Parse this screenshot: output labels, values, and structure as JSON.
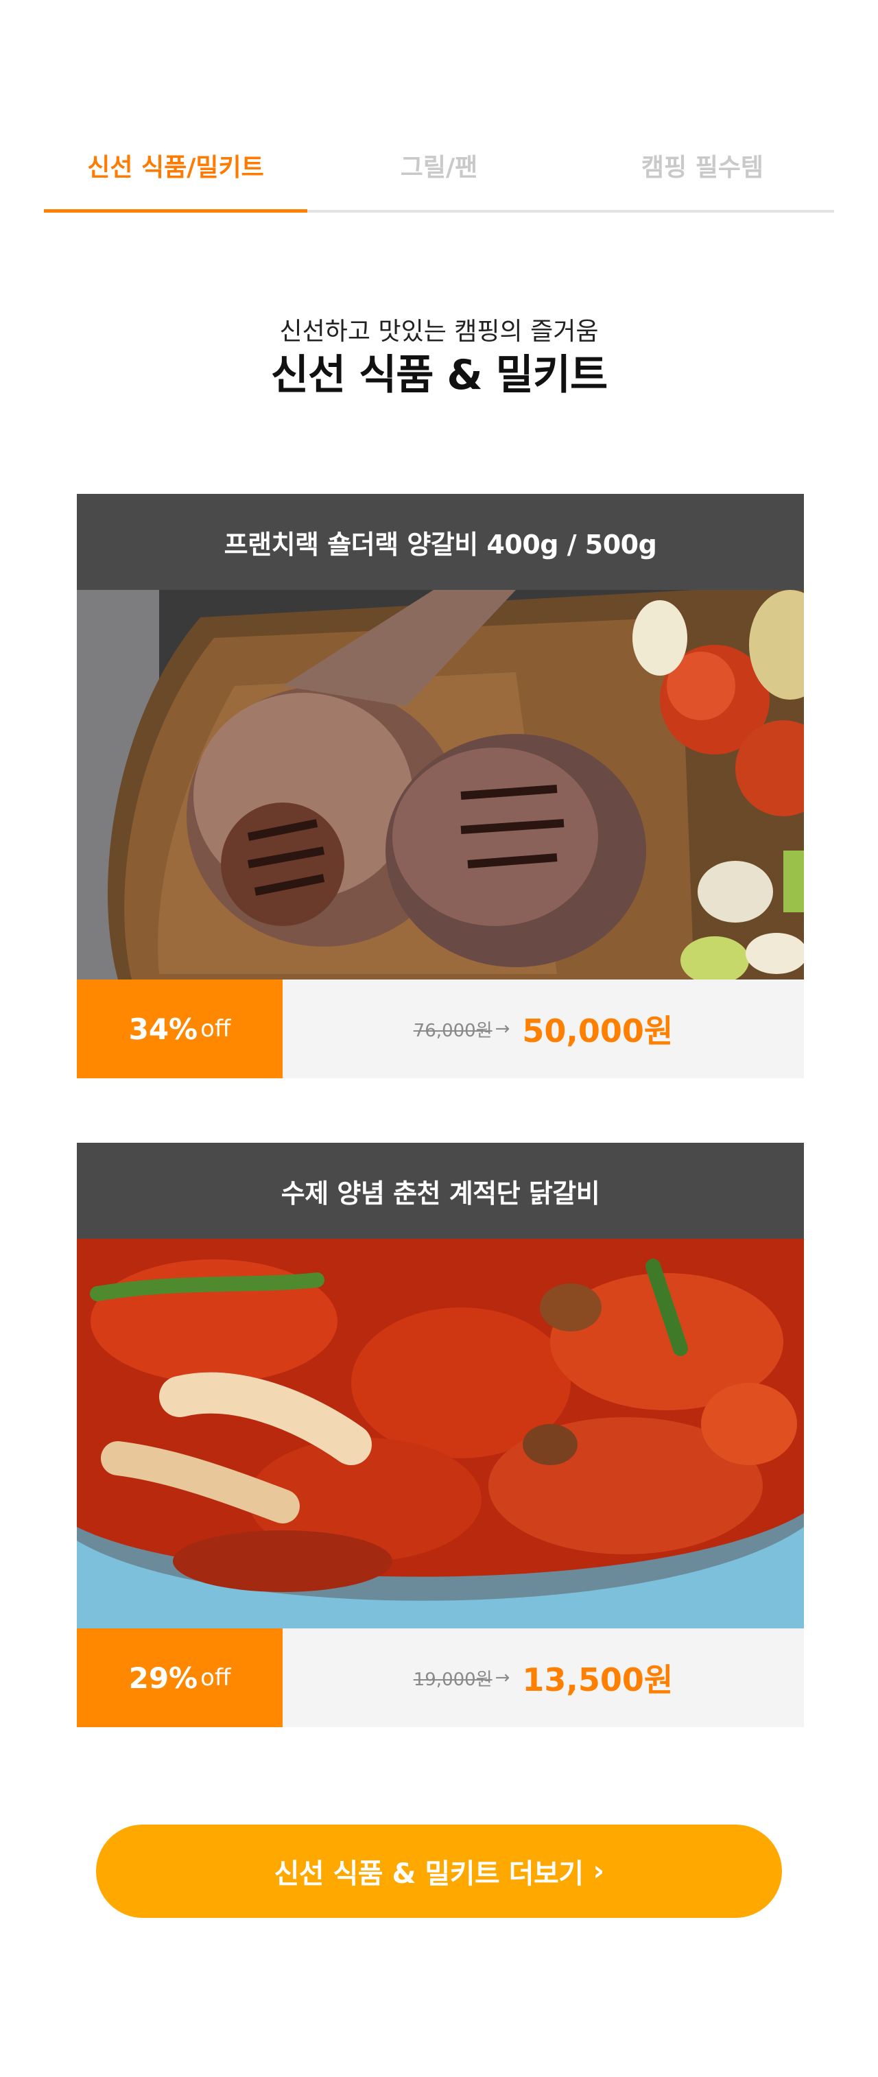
{
  "tabs": [
    {
      "label": "신선 식품/밀키트",
      "active": true
    },
    {
      "label": "그릴/팬",
      "active": false
    },
    {
      "label": "캠핑 필수템",
      "active": false
    }
  ],
  "section": {
    "subtitle": "신선하고 맛있는 캠핑의 즐거움",
    "title": "신선 식품 & 밀키트"
  },
  "products": [
    {
      "title": "프랜치랙 숄더랙 양갈비 400g / 500g",
      "discount_pct": "34%",
      "discount_suffix": "off",
      "original_price": "76,000원",
      "sale_price": "50,000원"
    },
    {
      "title": "수제 양념 춘천 계적단 닭갈비",
      "discount_pct": "29%",
      "discount_suffix": "off",
      "original_price": "19,000원",
      "sale_price": "13,500원"
    }
  ],
  "more_button": {
    "label": "신선 식품 & 밀키트 더보기",
    "icon": "chevron-right-icon"
  },
  "colors": {
    "accent": "#ff8000",
    "button": "#ffa800",
    "card_header": "#4a4a4a",
    "price_bg": "#f4f4f4"
  }
}
